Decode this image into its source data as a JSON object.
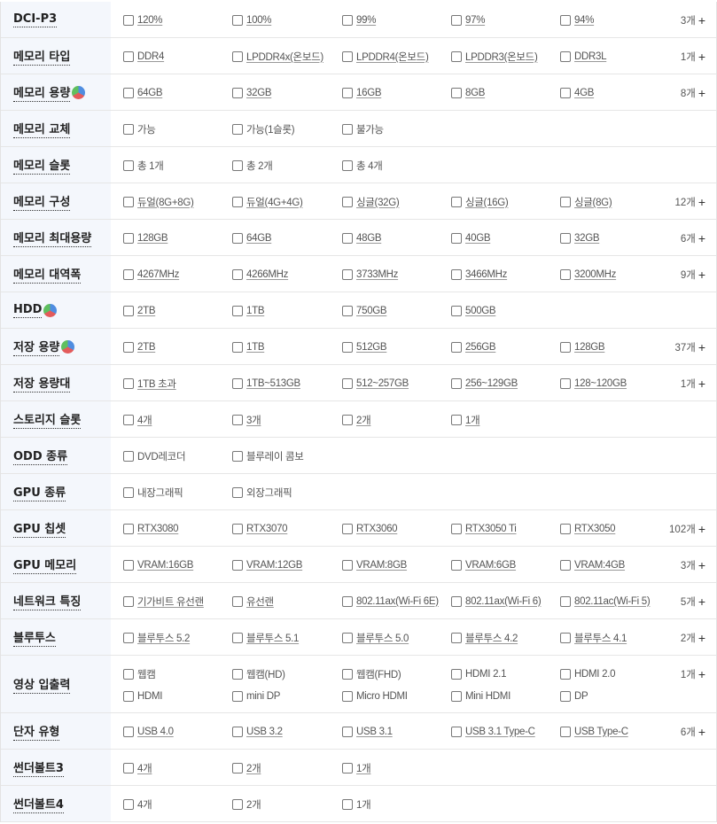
{
  "rows": [
    {
      "label": "DCI-P3",
      "pie": false,
      "options": [
        "120%",
        "100%",
        "99%",
        "97%",
        "94%"
      ],
      "more": "3개"
    },
    {
      "label": "메모리 타입",
      "pie": false,
      "options": [
        "DDR4",
        "LPDDR4x(온보드)",
        "LPDDR4(온보드)",
        "LPDDR3(온보드)",
        "DDR3L"
      ],
      "more": "1개"
    },
    {
      "label": "메모리 용량",
      "pie": true,
      "options": [
        "64GB",
        "32GB",
        "16GB",
        "8GB",
        "4GB"
      ],
      "more": "8개"
    },
    {
      "label": "메모리 교체",
      "pie": false,
      "options": [
        "가능",
        "가능(1슬롯)",
        "불가능"
      ],
      "more": ""
    },
    {
      "label": "메모리 슬롯",
      "pie": false,
      "options": [
        "총 1개",
        "총 2개",
        "총 4개"
      ],
      "more": ""
    },
    {
      "label": "메모리 구성",
      "pie": false,
      "options": [
        "듀얼(8G+8G)",
        "듀얼(4G+4G)",
        "싱글(32G)",
        "싱글(16G)",
        "싱글(8G)"
      ],
      "more": "12개"
    },
    {
      "label": "메모리 최대용량",
      "pie": false,
      "options": [
        "128GB",
        "64GB",
        "48GB",
        "40GB",
        "32GB"
      ],
      "more": "6개"
    },
    {
      "label": "메모리 대역폭",
      "pie": false,
      "options": [
        "4267MHz",
        "4266MHz",
        "3733MHz",
        "3466MHz",
        "3200MHz"
      ],
      "more": "9개"
    },
    {
      "label": "HDD",
      "pie": true,
      "options": [
        "2TB",
        "1TB",
        "750GB",
        "500GB"
      ],
      "more": ""
    },
    {
      "label": "저장 용량",
      "pie": true,
      "options": [
        "2TB",
        "1TB",
        "512GB",
        "256GB",
        "128GB"
      ],
      "more": "37개"
    },
    {
      "label": "저장 용량대",
      "pie": false,
      "options": [
        "1TB 초과",
        "1TB~513GB",
        "512~257GB",
        "256~129GB",
        "128~120GB"
      ],
      "more": "1개"
    },
    {
      "label": "스토리지 슬롯",
      "pie": false,
      "options": [
        "4개",
        "3개",
        "2개",
        "1개"
      ],
      "more": ""
    },
    {
      "label": "ODD 종류",
      "pie": false,
      "options": [
        "DVD레코더",
        "블루레이 콤보"
      ],
      "more": ""
    },
    {
      "label": "GPU 종류",
      "pie": false,
      "options": [
        "내장그래픽",
        "외장그래픽"
      ],
      "more": ""
    },
    {
      "label": "GPU 칩셋",
      "pie": false,
      "options": [
        "RTX3080",
        "RTX3070",
        "RTX3060",
        "RTX3050 Ti",
        "RTX3050"
      ],
      "more": "102개"
    },
    {
      "label": "GPU 메모리",
      "pie": false,
      "options": [
        "VRAM:16GB",
        "VRAM:12GB",
        "VRAM:8GB",
        "VRAM:6GB",
        "VRAM:4GB"
      ],
      "more": "3개"
    },
    {
      "label": "네트워크 특징",
      "pie": false,
      "options": [
        "기가비트 유선랜",
        "유선랜",
        "802.11ax(Wi-Fi 6E)",
        "802.11ax(Wi-Fi 6)",
        "802.11ac(Wi-Fi 5)"
      ],
      "more": "5개"
    },
    {
      "label": "블루투스",
      "pie": false,
      "options": [
        "블루투스 5.2",
        "블루투스 5.1",
        "블루투스 5.0",
        "블루투스 4.2",
        "블루투스 4.1"
      ],
      "more": "2개"
    },
    {
      "label": "영상 입출력",
      "pie": false,
      "options": [
        "웹캠",
        "웹캠(HD)",
        "웹캠(FHD)",
        "HDMI 2.1",
        "HDMI 2.0",
        "HDMI",
        "mini DP",
        "Micro HDMI",
        "Mini HDMI",
        "DP"
      ],
      "more": "1개"
    },
    {
      "label": "단자 유형",
      "pie": false,
      "options": [
        "USB 4.0",
        "USB 3.2",
        "USB 3.1",
        "USB 3.1 Type-C",
        "USB Type-C"
      ],
      "more": "6개"
    },
    {
      "label": "썬더볼트3",
      "pie": false,
      "options": [
        "4개",
        "2개",
        "1개"
      ],
      "more": ""
    },
    {
      "label": "썬더볼트4",
      "pie": false,
      "options": [
        "4개",
        "2개",
        "1개"
      ],
      "more": ""
    }
  ],
  "underline_flags": {
    "메모리 교체": false,
    "메모리 슬롯": false,
    "ODD 종류": false,
    "GPU 종류": false,
    "썬더볼트4": false,
    "영상 입출력": false
  },
  "more_suffix": "+",
  "colors": {
    "label_bg": "#f4f7fc",
    "border": "#e6e6e6",
    "text": "#555555"
  }
}
